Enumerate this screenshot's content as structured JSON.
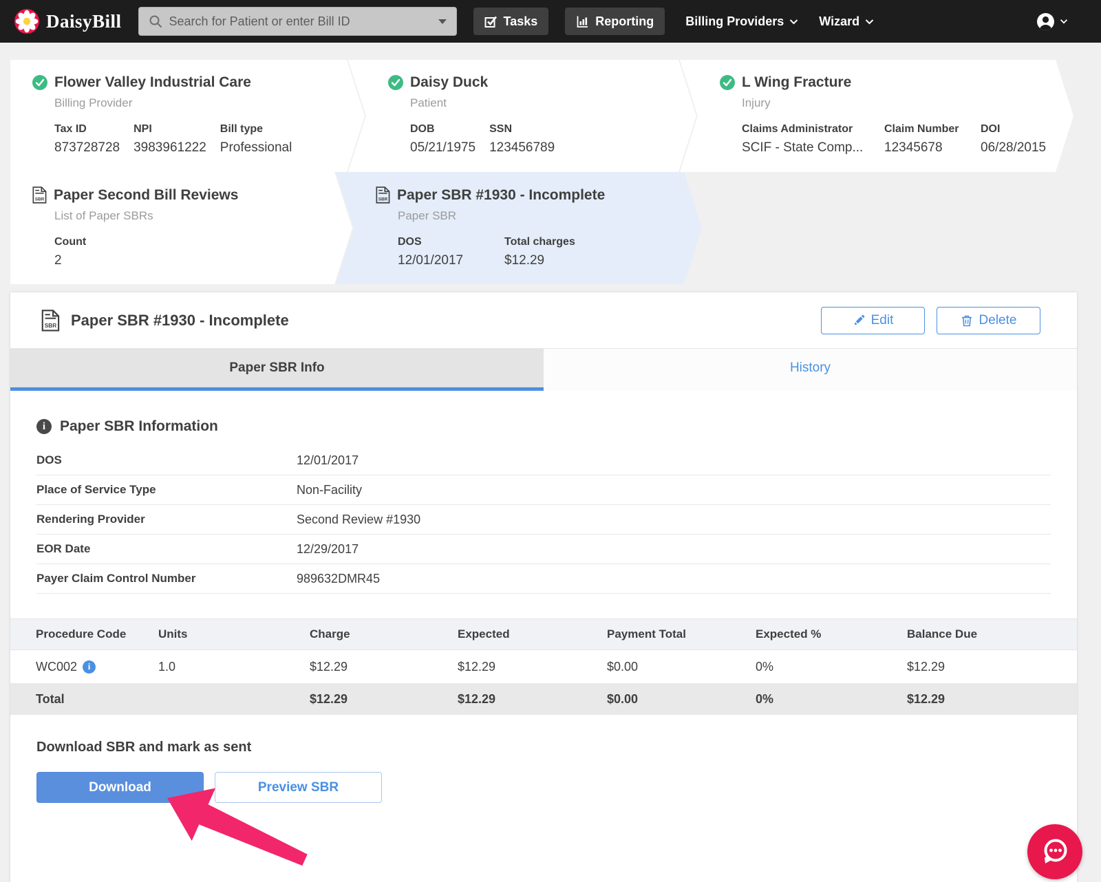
{
  "navbar": {
    "brand": "DaisyBill",
    "search_placeholder": "Search for Patient or enter Bill ID",
    "tasks_label": "Tasks",
    "reporting_label": "Reporting",
    "billing_providers_label": "Billing Providers",
    "wizard_label": "Wizard"
  },
  "breadcrumbs": [
    {
      "title": "Flower Valley Industrial Care",
      "subtitle": "Billing Provider",
      "fields": [
        {
          "label": "Tax ID",
          "value": "873728728"
        },
        {
          "label": "NPI",
          "value": "3983961222"
        },
        {
          "label": "Bill type",
          "value": "Professional"
        }
      ]
    },
    {
      "title": "Daisy Duck",
      "subtitle": "Patient",
      "fields": [
        {
          "label": "DOB",
          "value": "05/21/1975"
        },
        {
          "label": "SSN",
          "value": "123456789"
        }
      ]
    },
    {
      "title": "L Wing Fracture",
      "subtitle": "Injury",
      "fields": [
        {
          "label": "Claims Administrator",
          "value": "SCIF - State Comp..."
        },
        {
          "label": "Claim Number",
          "value": "12345678"
        },
        {
          "label": "DOI",
          "value": "06/28/2015"
        }
      ]
    },
    {
      "title": "Paper Second Bill Reviews",
      "subtitle": "List of Paper SBRs",
      "fields": [
        {
          "label": "Count",
          "value": "2"
        }
      ]
    },
    {
      "title": "Paper SBR #1930 - Incomplete",
      "subtitle": "Paper SBR",
      "fields": [
        {
          "label": "DOS",
          "value": "12/01/2017"
        },
        {
          "label": "Total charges",
          "value": "$12.29"
        }
      ]
    }
  ],
  "detail_panel": {
    "title": "Paper SBR #1930 - Incomplete",
    "edit_label": "Edit",
    "delete_label": "Delete",
    "tabs": [
      {
        "label": "Paper SBR Info"
      },
      {
        "label": "History"
      }
    ]
  },
  "sbr_info": {
    "heading": "Paper SBR Information",
    "fields": [
      {
        "label": "DOS",
        "value": "12/01/2017"
      },
      {
        "label": "Place of Service Type",
        "value": "Non-Facility"
      },
      {
        "label": "Rendering Provider",
        "value": "Second Review #1930"
      },
      {
        "label": "EOR Date",
        "value": "12/29/2017"
      },
      {
        "label": "Payer Claim Control Number",
        "value": "989632DMR45"
      }
    ]
  },
  "line_items": {
    "columns": [
      "Procedure Code",
      "Units",
      "Charge",
      "Expected",
      "Payment Total",
      "Expected %",
      "Balance Due"
    ],
    "rows": [
      {
        "cells": [
          "WC002",
          "1.0",
          "$12.29",
          "$12.29",
          "$0.00",
          "0%",
          "$12.29"
        ]
      }
    ],
    "total_row": {
      "cells": [
        "Total",
        "",
        "$12.29",
        "$12.29",
        "$0.00",
        "0%",
        "$12.29"
      ]
    }
  },
  "download_section": {
    "heading": "Download SBR and mark as sent",
    "download_label": "Download",
    "preview_label": "Preview SBR"
  },
  "icons": {
    "info_glyph": "i",
    "sbr_doc_label": "SBR"
  },
  "colors": {
    "accent_blue": "#4a90e2",
    "success_green": "#3ebb85",
    "brand_red": "#e8174c",
    "arrow_pink": "#f2266b",
    "navbar_bg": "#1d1d1d",
    "active_card_bg": "#e4edf9"
  }
}
